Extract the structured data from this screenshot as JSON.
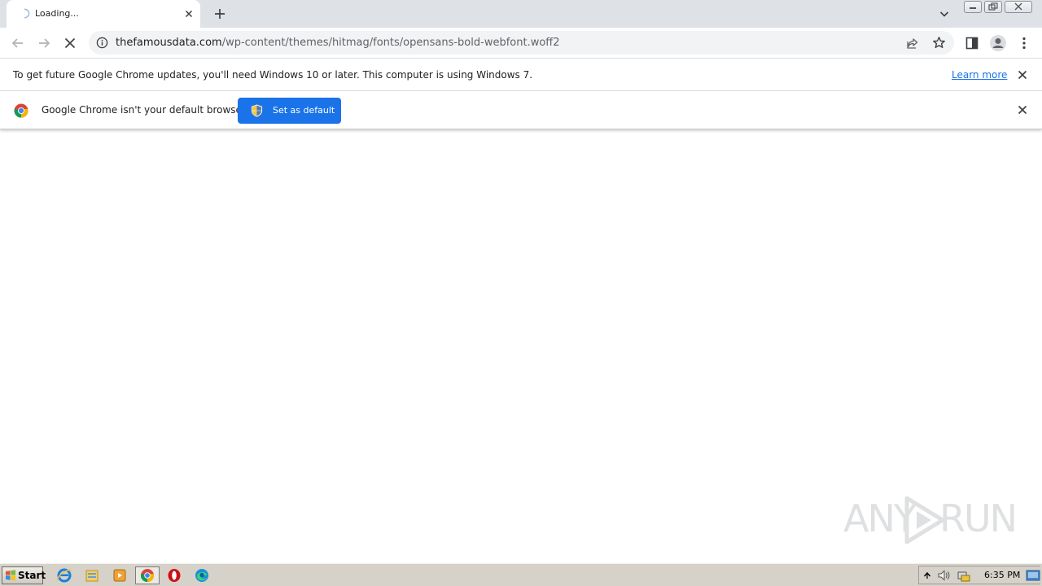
{
  "tab": {
    "title": "Loading...",
    "close": "×"
  },
  "toolbar": {
    "url_host": "thefamousdata.com",
    "url_path": "/wp-content/themes/hitmag/fonts/opensans-bold-webfont.woff2"
  },
  "update_bar": {
    "message": "To get future Google Chrome updates, you'll need Windows 10 or later. This computer is using Windows 7.",
    "link": "Learn more"
  },
  "default_bar": {
    "message": "Google Chrome isn't your default browser",
    "button": "Set as default"
  },
  "watermark": {
    "left": "ANY",
    "right": "RUN"
  },
  "taskbar": {
    "start": "Start",
    "apps": [
      "internet-explorer-icon",
      "file-explorer-icon",
      "media-player-icon",
      "chrome-icon",
      "opera-icon",
      "edge-icon"
    ],
    "clock": "6:35 PM"
  },
  "colors": {
    "accent": "#1a73e8",
    "tabstrip": "#dee1e6",
    "taskbar": "#d6d2c9"
  }
}
